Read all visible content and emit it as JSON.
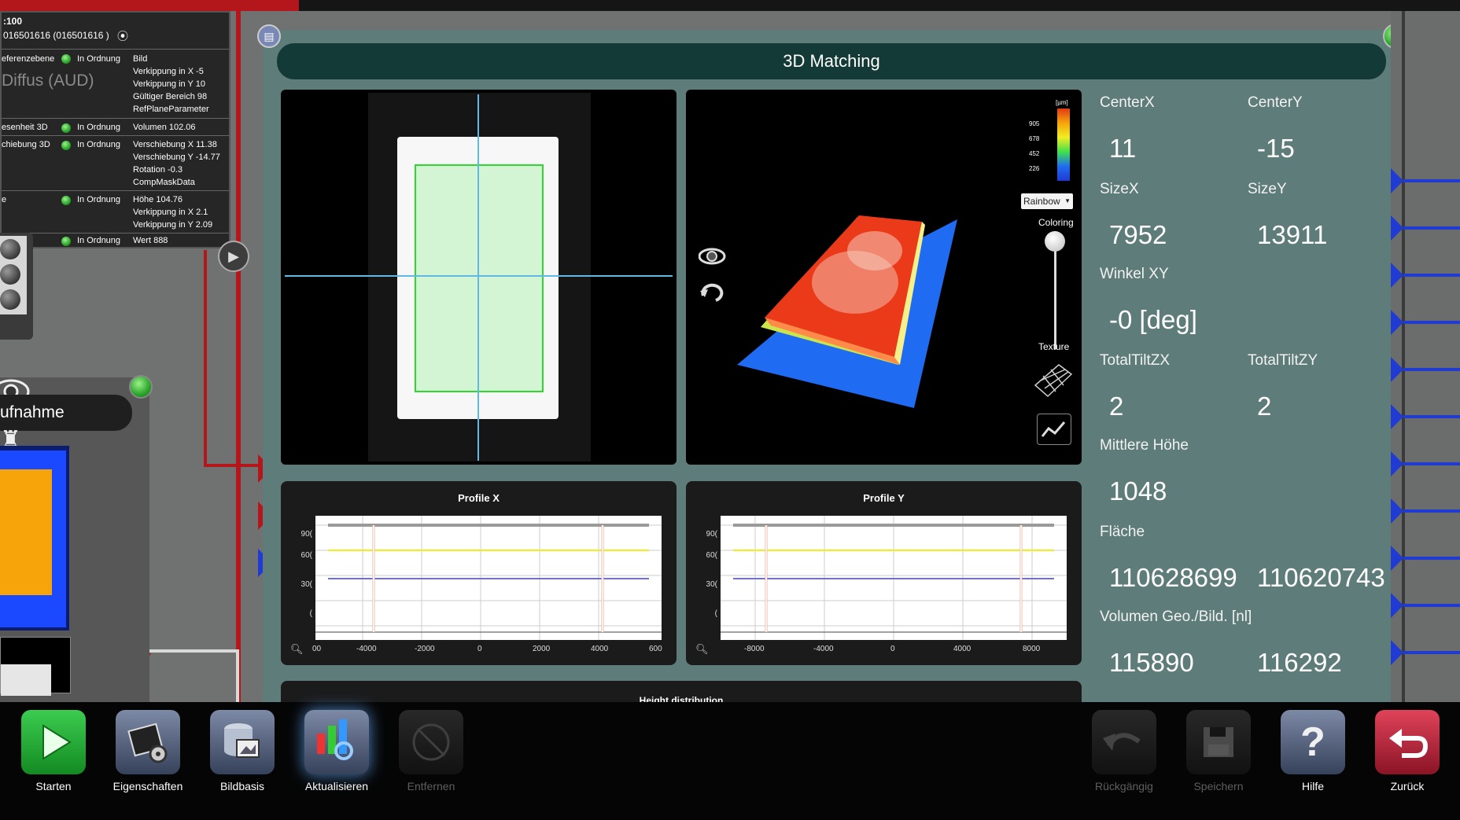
{
  "info_panel": {
    "header_line1": ":100",
    "header_line2": "016501616 (016501616 )",
    "rows": [
      {
        "name": "eferenzebene",
        "status": "In Ordnung",
        "params": [
          "Bild",
          "Verkippung in X -5",
          "Verkippung in Y 10",
          "Gültiger Bereich 98",
          "RefPlaneParameter"
        ]
      },
      {
        "name": "esenheit 3D",
        "status": "In Ordnung",
        "params": [
          "Volumen 102.06"
        ]
      },
      {
        "name": "chiebung 3D",
        "status": "In Ordnung",
        "params": [
          "Verschiebung X 11.38",
          "Verschiebung Y -14.77",
          "Rotation -0.3",
          "CompMaskData"
        ]
      },
      {
        "name": "e",
        "status": "In Ordnung",
        "params": [
          "Höhe 104.76",
          "Verkippung in X 2.1",
          "Verkippung in Y 2.09"
        ]
      },
      {
        "name": "",
        "status": "In Ordnung",
        "params": [
          "Wert 888"
        ]
      }
    ],
    "big_label": "Diffus (AUD)"
  },
  "left_node": {
    "title": "ufnahme"
  },
  "panel": {
    "title": "3D Matching"
  },
  "view3d": {
    "colorbar_unit": "[µm]",
    "colorbar_ticks": [
      "905",
      "678",
      "452",
      "226"
    ],
    "palette": "Rainbow",
    "slider_top": "Coloring",
    "slider_bottom": "Texture"
  },
  "profile_x": {
    "title": "Profile X",
    "y_ticks": [
      "90(",
      "60(",
      "30(",
      "("
    ],
    "x_ticks": [
      "00",
      "-4000",
      "-2000",
      "0",
      "2000",
      "4000",
      "600"
    ]
  },
  "profile_y": {
    "title": "Profile Y",
    "y_ticks": [
      "90(",
      "60(",
      "30(",
      "("
    ],
    "x_ticks": [
      "-8000",
      "-4000",
      "0",
      "4000",
      "8000"
    ]
  },
  "height_distribution": {
    "title": "Height distribution"
  },
  "stats": {
    "centerx_label": "CenterX",
    "centerx": "11",
    "centery_label": "CenterY",
    "centery": "-15",
    "sizex_label": "SizeX",
    "sizex": "7952",
    "sizey_label": "SizeY",
    "sizey": "13911",
    "winkel_label": "Winkel XY",
    "winkel": "-0 [deg]",
    "tiltzx_label": "TotalTiltZX",
    "tiltzx": "2",
    "tiltzy_label": "TotalTiltZY",
    "tiltzy": "2",
    "mhoehe_label": "Mittlere Höhe",
    "mhoehe": "1048",
    "flaeche_label": "Fläche",
    "flaeche1": "110628699",
    "flaeche2": "110620743",
    "volumen_label": "Volumen Geo./Bild. [nl]",
    "volumen1": "115890",
    "volumen2": "116292"
  },
  "toolbar": {
    "starten": "Starten",
    "eigenschaften": "Eigenschaften",
    "bildbasis": "Bildbasis",
    "aktualisieren": "Aktualisieren",
    "entfernen": "Entfernen",
    "rueckgaengig": "Rückgängig",
    "speichern": "Speichern",
    "hilfe": "Hilfe",
    "zurueck": "Zurück"
  },
  "colors": {
    "panel_bg": "#5e7c7a",
    "title_bg": "#133a37",
    "status_ok": "#2aa52a",
    "connector_red": "#b3161b",
    "connector_blue": "#1f3bd1"
  }
}
